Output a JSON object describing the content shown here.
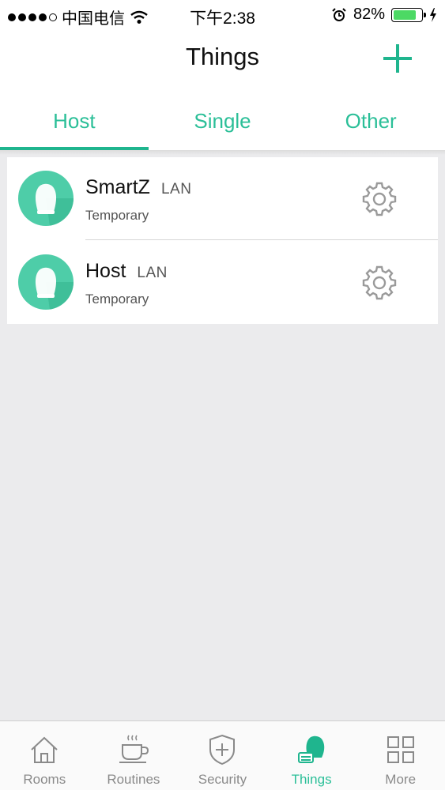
{
  "status_bar": {
    "carrier": "中国电信",
    "time": "下午2:38",
    "battery_percent": "82%",
    "battery_level": 0.82,
    "icons": [
      "signal-dots-icon",
      "wifi-icon",
      "alarm-icon",
      "battery-icon",
      "charging-icon"
    ]
  },
  "header": {
    "title": "Things",
    "add_icon": "plus-icon"
  },
  "tabs": [
    {
      "label": "Host",
      "active": true
    },
    {
      "label": "Single",
      "active": false
    },
    {
      "label": "Other",
      "active": false
    }
  ],
  "devices": [
    {
      "name": "SmartZ",
      "connection": "LAN",
      "status": "Temporary",
      "icon": "host-device-icon",
      "action_icon": "gear-icon"
    },
    {
      "name": "Host",
      "connection": "LAN",
      "status": "Temporary",
      "icon": "host-device-icon",
      "action_icon": "gear-icon"
    }
  ],
  "tab_bar": [
    {
      "label": "Rooms",
      "icon": "house-icon",
      "active": false
    },
    {
      "label": "Routines",
      "icon": "coffee-cup-icon",
      "active": false
    },
    {
      "label": "Security",
      "icon": "shield-icon",
      "active": false
    },
    {
      "label": "Things",
      "icon": "things-icon",
      "active": true
    },
    {
      "label": "More",
      "icon": "grid-icon",
      "active": false
    }
  ],
  "colors": {
    "accent": "#2bbf98",
    "avatar": "#4ecda8",
    "background": "#ebebed"
  }
}
